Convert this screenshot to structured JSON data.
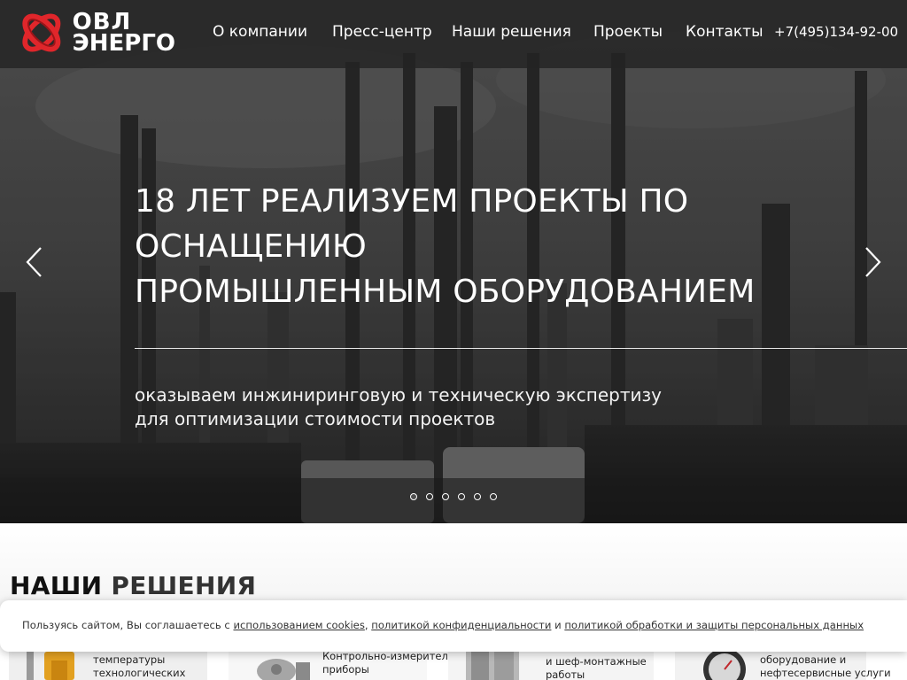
{
  "brand": {
    "line1": "ОВЛ",
    "line2": "ЭНЕРГО",
    "colors": {
      "accent": "#e0262b",
      "accent_dark": "#9c1418"
    }
  },
  "nav": {
    "items": [
      {
        "label": "О компании"
      },
      {
        "label": "Пресс-центр"
      },
      {
        "label": "Наши решения"
      },
      {
        "label": "Проекты"
      },
      {
        "label": "Контакты"
      }
    ],
    "phone": "+7(495)134-92-00"
  },
  "hero": {
    "title_lines": [
      "18 ЛЕТ РЕАЛИЗУЕМ ПРОЕКТЫ ПО",
      "ОСНАЩЕНИЮ",
      "ПРОМЫШЛЕННЫМ ОБОРУДОВАНИЕМ"
    ],
    "subtitle_lines": [
      "оказываем инжиниринговую и техническую экспертизу",
      "для оптимизации стоимости проектов"
    ],
    "prev_icon": "chevron-left-icon",
    "next_icon": "chevron-right-icon",
    "slide_count": 6,
    "active_slide": 0
  },
  "solutions": {
    "title_part1": "НАШИ",
    "title_part2": "РЕШЕНИЯ",
    "cards": [
      {
        "line1": "температуры",
        "line2": "технологических"
      },
      {
        "line1": "Контрольно-измерительные",
        "line2": "приборы"
      },
      {
        "line1": "и шеф-монтажные",
        "line2": "работы"
      },
      {
        "line1": "оборудование и",
        "line2": "нефтесервисные услуги"
      }
    ]
  },
  "cookie": {
    "prefix": "Пользуясь сайтом, Вы соглашаетесь с ",
    "link1": "использованием cookies",
    "sep1": ", ",
    "link2": "политикой конфиденциальности",
    "sep2": " и ",
    "link3": "политикой обработки и защиты персональных данных"
  }
}
